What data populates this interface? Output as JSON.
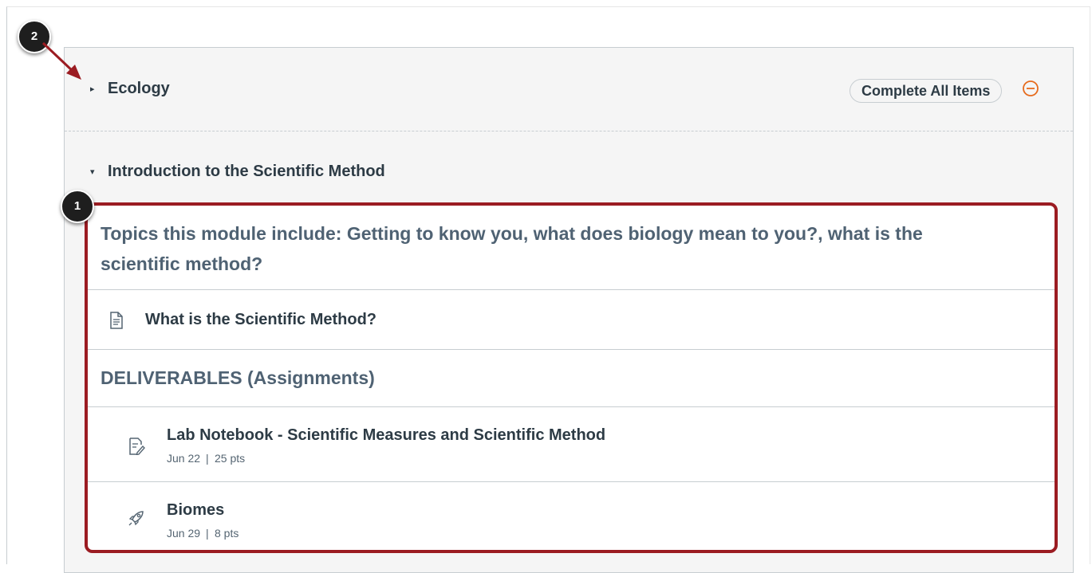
{
  "modules": [
    {
      "title": "Ecology",
      "collapsed": true,
      "complete_all_label": "Complete All Items",
      "remove_icon": "minus-circle-icon"
    },
    {
      "title": "Introduction to the Scientific Method",
      "collapsed": false
    }
  ],
  "items": {
    "intro_text": "Topics this module include: Getting to know you, what does biology mean to you?, what is the scientific method?",
    "page_item": {
      "title": "What is the Scientific Method?",
      "icon": "document-icon"
    },
    "deliverables_header": "DELIVERABLES (Assignments)",
    "assignments": [
      {
        "title": "Lab Notebook - Scientific Measures and Scientific Method",
        "date": "Jun 22",
        "points": "25 pts",
        "icon": "assignment-icon"
      },
      {
        "title": "Biomes",
        "date": "Jun 29",
        "points": "8 pts",
        "icon": "rocket-icon"
      }
    ]
  },
  "callouts": [
    {
      "number": "1"
    },
    {
      "number": "2"
    }
  ],
  "colors": {
    "highlight_border": "#9b1c22",
    "remove_icon": "#e66b1d",
    "panel_bg": "#f5f5f5"
  }
}
